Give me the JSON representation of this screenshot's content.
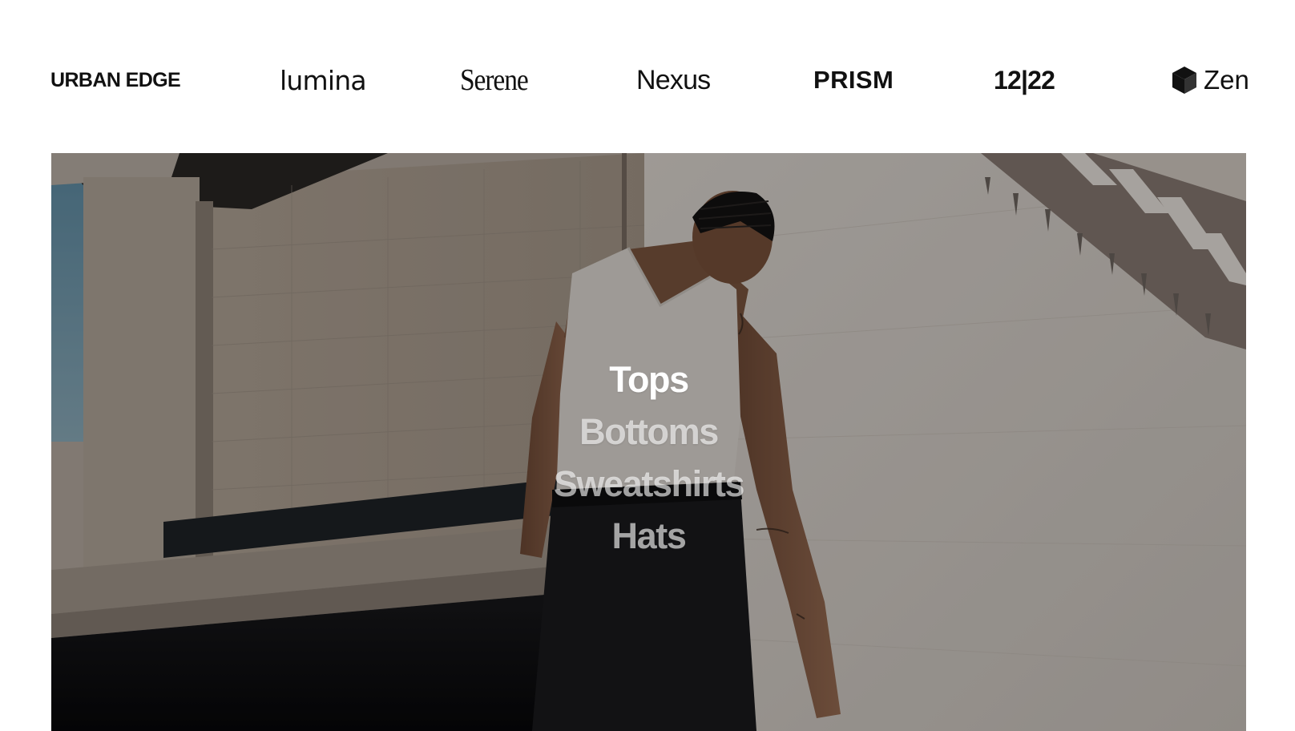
{
  "brands": [
    {
      "id": "urban-edge",
      "label": "URBAN EDGE"
    },
    {
      "id": "lumina",
      "label": "lumina"
    },
    {
      "id": "serene",
      "label": "Serene"
    },
    {
      "id": "nexus",
      "label": "Nexus"
    },
    {
      "id": "prism",
      "label": "PRISM"
    },
    {
      "id": "1222",
      "label": "12|22"
    },
    {
      "id": "zen",
      "label": "Zen",
      "icon": "cube-icon"
    }
  ],
  "hero": {
    "categories": [
      {
        "label": "Tops",
        "active": true
      },
      {
        "label": "Bottoms",
        "active": false
      },
      {
        "label": "Sweatshirts",
        "active": false
      },
      {
        "label": "Hats",
        "active": false
      }
    ]
  },
  "colors": {
    "text_dark": "#111111",
    "category_active": "#ffffff",
    "category_inactive": "rgba(255,255,255,0.62)"
  }
}
